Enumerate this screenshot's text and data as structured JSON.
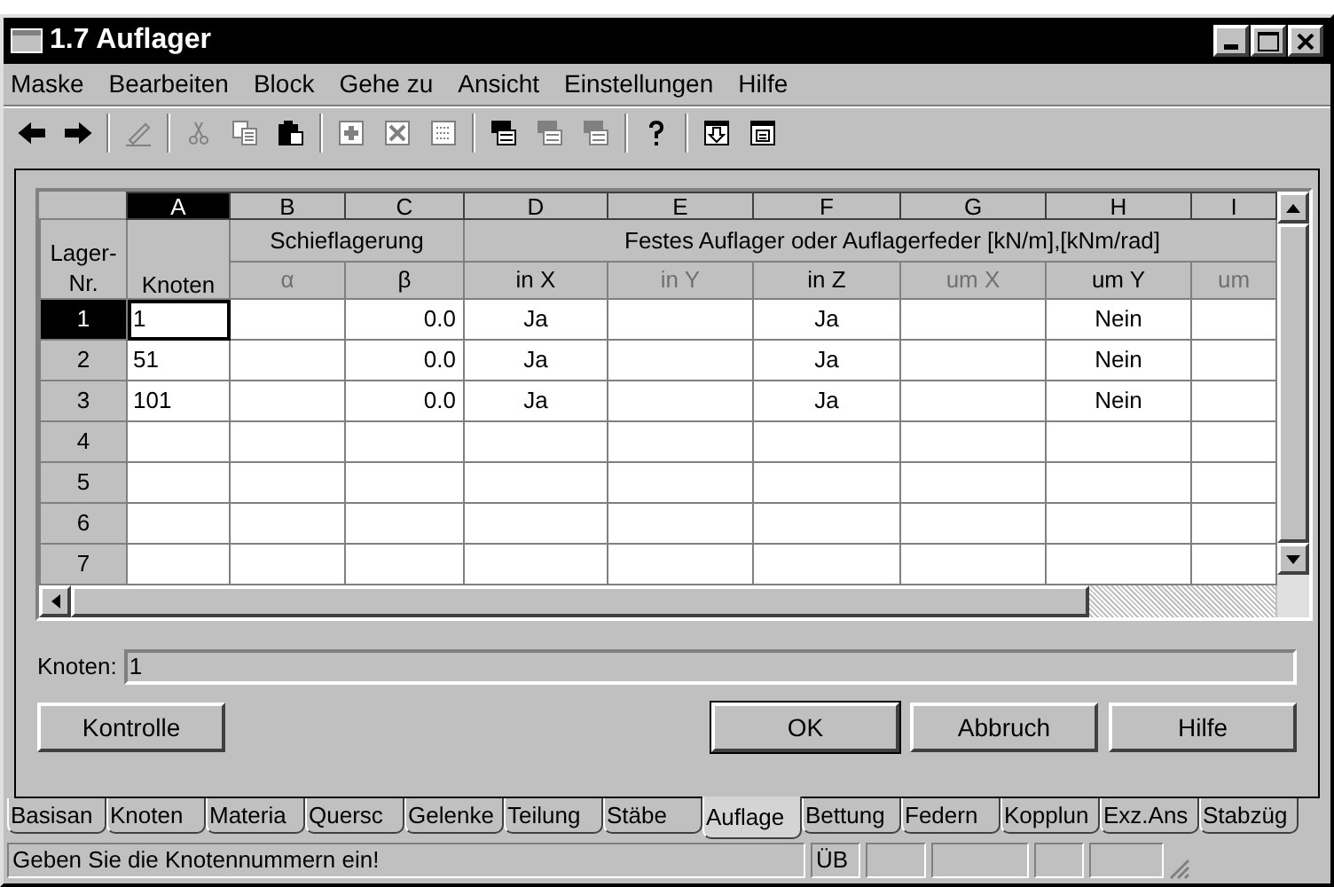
{
  "window": {
    "title": "1.7 Auflager"
  },
  "menu": [
    {
      "label": "Maske"
    },
    {
      "label": "Bearbeiten"
    },
    {
      "label": "Block"
    },
    {
      "label": "Gehe zu"
    },
    {
      "label": "Ansicht"
    },
    {
      "label": "Einstellungen"
    },
    {
      "label": "Hilfe"
    }
  ],
  "toolbar": [
    {
      "kind": "back",
      "disabled": false
    },
    {
      "kind": "forward",
      "disabled": false
    },
    {
      "kind": "separator"
    },
    {
      "kind": "pencil",
      "disabled": true
    },
    {
      "kind": "separator"
    },
    {
      "kind": "scissors",
      "disabled": true
    },
    {
      "kind": "copy",
      "disabled": true
    },
    {
      "kind": "paste",
      "disabled": false
    },
    {
      "kind": "separator"
    },
    {
      "kind": "plus",
      "disabled": true
    },
    {
      "kind": "cross",
      "disabled": true
    },
    {
      "kind": "grid",
      "disabled": true
    },
    {
      "kind": "separator"
    },
    {
      "kind": "stack",
      "disabled": false
    },
    {
      "kind": "stack",
      "disabled": true
    },
    {
      "kind": "stack",
      "disabled": true
    },
    {
      "kind": "separator"
    },
    {
      "kind": "help",
      "disabled": false
    },
    {
      "kind": "separator"
    },
    {
      "kind": "download",
      "disabled": false
    },
    {
      "kind": "form",
      "disabled": false
    }
  ],
  "table": {
    "row_header": "Lager-Nr.",
    "columns": [
      {
        "letter": "A",
        "selected": true,
        "heading": "Knoten",
        "disabled": false
      },
      {
        "letter": "B",
        "selected": false,
        "heading": "α",
        "disabled": true
      },
      {
        "letter": "C",
        "selected": false,
        "heading": "β",
        "disabled": false
      },
      {
        "letter": "D",
        "selected": false,
        "heading": "in X",
        "disabled": false
      },
      {
        "letter": "E",
        "selected": false,
        "heading": "in Y",
        "disabled": true
      },
      {
        "letter": "F",
        "selected": false,
        "heading": "in Z",
        "disabled": false
      },
      {
        "letter": "G",
        "selected": false,
        "heading": "um X",
        "disabled": true
      },
      {
        "letter": "H",
        "selected": false,
        "heading": "um Y",
        "disabled": false
      },
      {
        "letter": "I",
        "selected": false,
        "heading": "um",
        "disabled": true
      }
    ],
    "groups": [
      {
        "label": "Schieflagerung"
      },
      {
        "label": "Festes Auflager oder Auflagerfeder [kN/m],[kNm/rad]"
      }
    ],
    "rows": [
      {
        "number": "1",
        "selected": true,
        "cells": [
          "1",
          "",
          "0.0",
          "Ja",
          "",
          "Ja",
          "",
          "Nein",
          ""
        ]
      },
      {
        "number": "2",
        "selected": false,
        "cells": [
          "51",
          "",
          "0.0",
          "Ja",
          "",
          "Ja",
          "",
          "Nein",
          ""
        ]
      },
      {
        "number": "3",
        "selected": false,
        "cells": [
          "101",
          "",
          "0.0",
          "Ja",
          "",
          "Ja",
          "",
          "Nein",
          ""
        ]
      },
      {
        "number": "4",
        "selected": false,
        "cells": [
          "",
          "",
          "",
          "",
          "",
          "",
          "",
          "",
          ""
        ]
      },
      {
        "number": "5",
        "selected": false,
        "cells": [
          "",
          "",
          "",
          "",
          "",
          "",
          "",
          "",
          ""
        ]
      },
      {
        "number": "6",
        "selected": false,
        "cells": [
          "",
          "",
          "",
          "",
          "",
          "",
          "",
          "",
          ""
        ]
      },
      {
        "number": "7",
        "selected": false,
        "cells": [
          "",
          "",
          "",
          "",
          "",
          "",
          "",
          "",
          ""
        ]
      }
    ]
  },
  "info_field": {
    "label": "Knoten:",
    "value": "1"
  },
  "buttons": [
    {
      "label": "Kontrolle",
      "default": false
    },
    {
      "label": "OK",
      "default": true
    },
    {
      "label": "Abbruch",
      "default": false
    },
    {
      "label": "Hilfe",
      "default": false
    }
  ],
  "tabs": [
    {
      "label": "Basisan",
      "selected": false
    },
    {
      "label": "Knoten",
      "selected": false
    },
    {
      "label": "Materia",
      "selected": false
    },
    {
      "label": "Quersc",
      "selected": false
    },
    {
      "label": "Gelenke",
      "selected": false
    },
    {
      "label": "Teilung",
      "selected": false
    },
    {
      "label": "Stäbe",
      "selected": false
    },
    {
      "label": "Auflage",
      "selected": true
    },
    {
      "label": "Bettung",
      "selected": false
    },
    {
      "label": "Federn",
      "selected": false
    },
    {
      "label": "Kopplun",
      "selected": false
    },
    {
      "label": "Exz.Ans",
      "selected": false
    },
    {
      "label": "Stabzüg",
      "selected": false
    }
  ],
  "status_bar": {
    "message": "Geben Sie die Knotennummern ein!",
    "indicator": "ÜB"
  }
}
